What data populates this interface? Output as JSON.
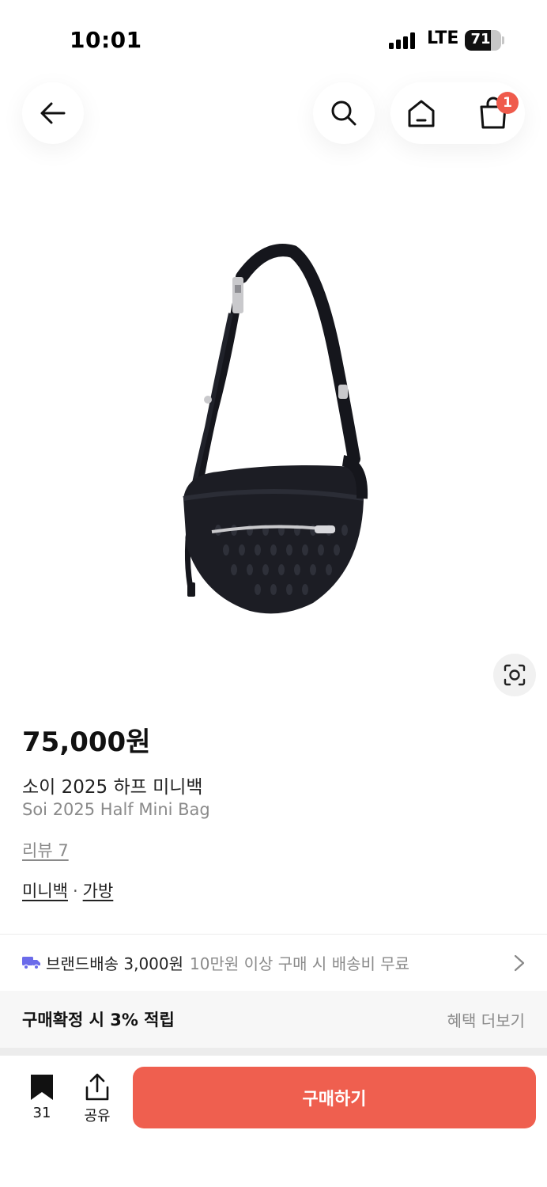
{
  "status_bar": {
    "time": "10:01",
    "network": "LTE",
    "battery_percent": "71"
  },
  "nav": {
    "cart_count": "1"
  },
  "product": {
    "price": "75,000원",
    "name_ko": "소이 2025 하프 미니백",
    "name_en": "Soi 2025 Half Mini Bag",
    "reviews": "리뷰 7",
    "categories": [
      "미니백",
      "가방"
    ],
    "category_separator": "·"
  },
  "shipping": {
    "label": "브랜드배송 3,000원",
    "sub": "10만원 이상 구매 시 배송비 무료",
    "truck_color": "#6b6bea"
  },
  "benefit": {
    "title": "구매확정 시 3% 적립",
    "more": "혜택 더보기"
  },
  "bottom_bar": {
    "bookmark_count": "31",
    "share_label": "공유",
    "buy_label": "구매하기",
    "buy_color": "#ef5f4f"
  }
}
